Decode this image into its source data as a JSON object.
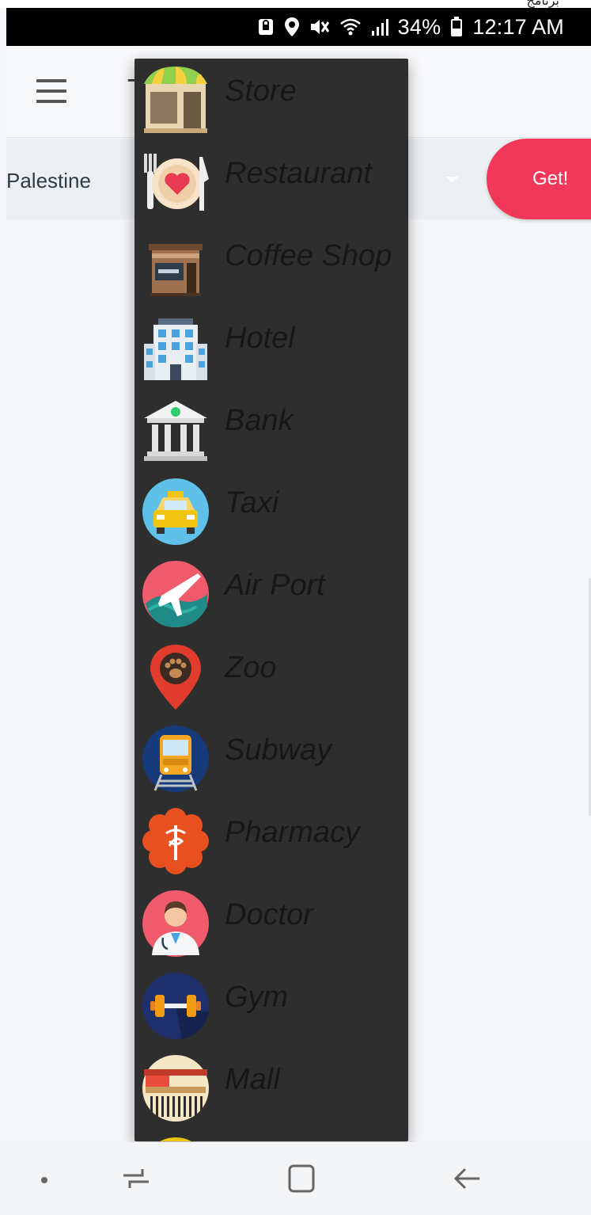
{
  "status_bar": {
    "carrier_text": "ﺑﺮﻧﺎﻣﺞ",
    "battery_percent": "34%",
    "time": "12:17 AM",
    "icons": [
      "lock-icon",
      "location-icon",
      "mute-icon",
      "wifi-icon",
      "signal-icon",
      "battery-icon"
    ]
  },
  "app_bar": {
    "menu_icon": "hamburger-menu-icon",
    "title": "T"
  },
  "filter": {
    "country": "Palestine",
    "get_label": "Get!"
  },
  "dropdown": {
    "items": [
      {
        "label": "Store",
        "icon": "store-icon"
      },
      {
        "label": "Restaurant",
        "icon": "restaurant-icon"
      },
      {
        "label": "Coffee Shop",
        "icon": "coffee-shop-icon"
      },
      {
        "label": "Hotel",
        "icon": "hotel-icon"
      },
      {
        "label": "Bank",
        "icon": "bank-icon"
      },
      {
        "label": "Taxi",
        "icon": "taxi-icon"
      },
      {
        "label": "Air Port",
        "icon": "airport-icon"
      },
      {
        "label": "Zoo",
        "icon": "zoo-icon"
      },
      {
        "label": "Subway",
        "icon": "subway-icon"
      },
      {
        "label": "Pharmacy",
        "icon": "pharmacy-icon"
      },
      {
        "label": "Doctor",
        "icon": "doctor-icon"
      },
      {
        "label": "Gym",
        "icon": "gym-icon"
      },
      {
        "label": "Mall",
        "icon": "mall-icon"
      }
    ]
  },
  "nav_bar": {
    "buttons": [
      "dot-icon",
      "recents-icon",
      "home-icon",
      "back-icon"
    ]
  },
  "colors": {
    "accent": "#f2385a",
    "dropdown_bg": "#2e2e2e",
    "status_bar_bg": "#000000"
  }
}
